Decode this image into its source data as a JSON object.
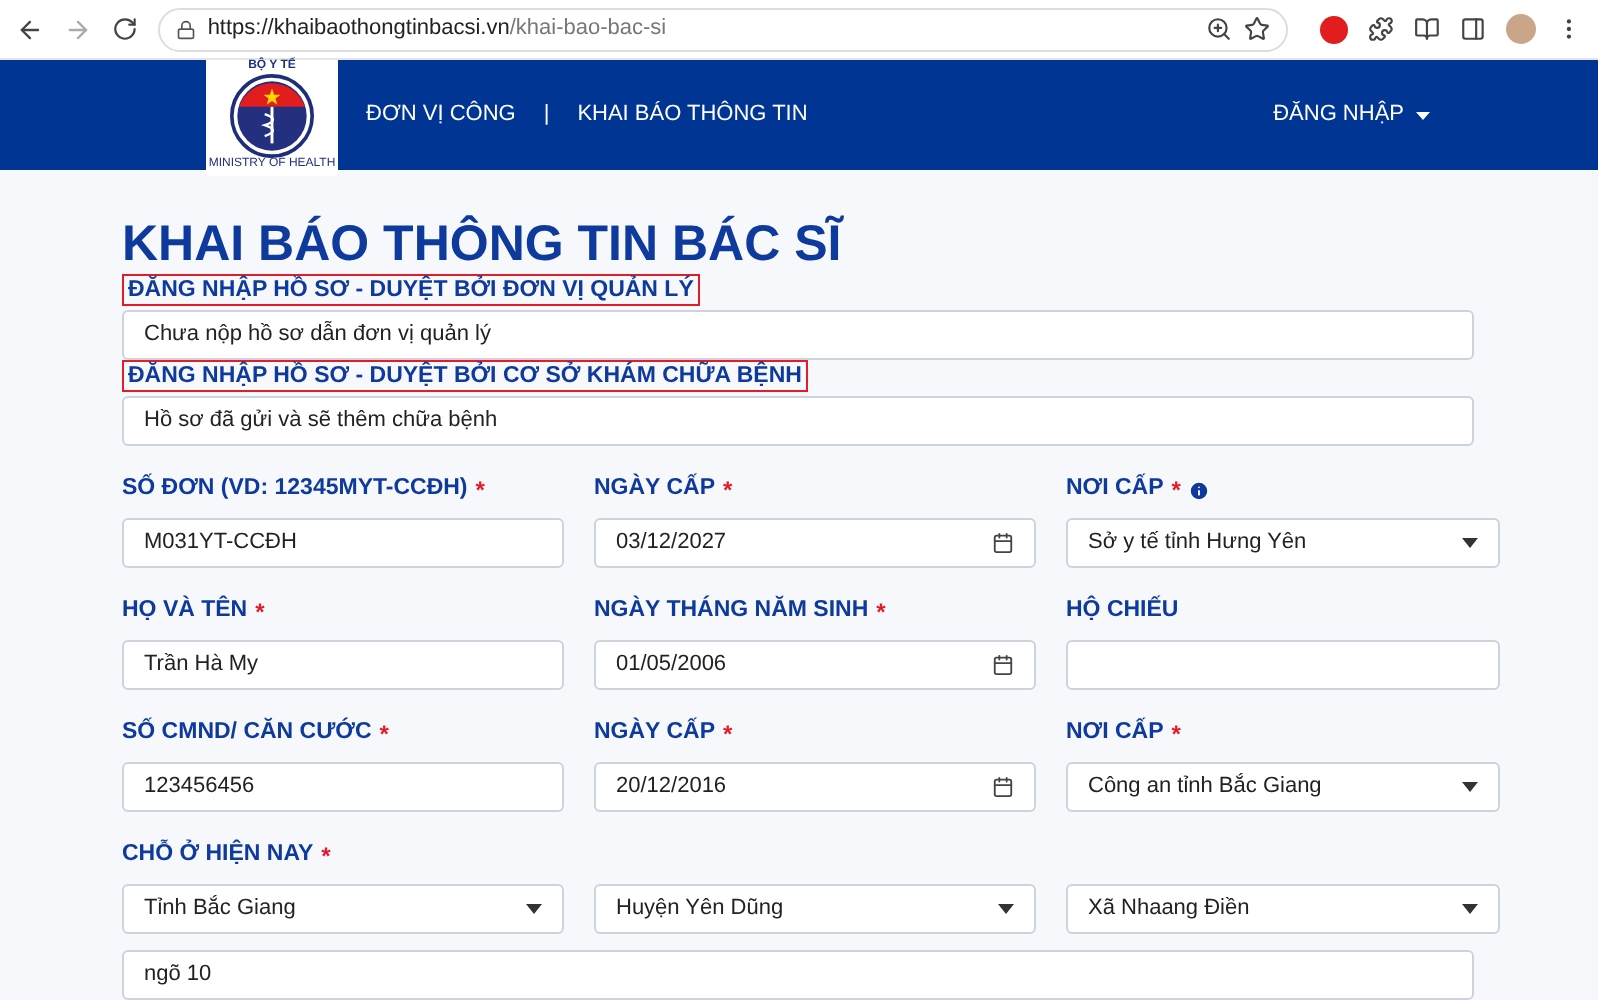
{
  "browser": {
    "url_host": "https://khaibaothongtinbacsi.vn",
    "url_path": "/khai-bao-bac-si"
  },
  "header": {
    "logo_top": "BỘ Y TẾ",
    "logo_bottom": "MINISTRY OF HEALTH",
    "nav": [
      "ĐƠN VỊ CÔNG",
      "KHAI BÁO THÔNG TIN"
    ],
    "separator": "|",
    "login": "ĐĂNG NHẬP"
  },
  "title": "KHAI BÁO THÔNG TIN BÁC SĨ",
  "status_sections": [
    {
      "label": "ĐĂNG NHẬP HỒ SƠ - DUYỆT BỞI ĐƠN VỊ QUẢN LÝ",
      "value": "Chưa nộp hồ sơ dẫn đơn vị quản lý",
      "highlighted": true
    },
    {
      "label": "ĐĂNG NHẬP HỒ SƠ - DUYỆT BỞI CƠ SỞ KHÁM CHỮA BỆNH",
      "value": "Hồ sơ đã gửi và sẽ thêm chữa bệnh",
      "highlighted": true
    }
  ],
  "field_rows": [
    [
      {
        "label": "SỐ ĐƠN (VD: 12345MYT-CCĐH)",
        "required": true,
        "info": false,
        "kind": "text",
        "value": "M031YT-CCĐH"
      },
      {
        "label": "NGÀY CẤP",
        "required": true,
        "info": false,
        "kind": "date",
        "value": "03/12/2027"
      },
      {
        "label": "NƠI CẤP",
        "required": true,
        "info": true,
        "kind": "select",
        "value": "Sở y tế tỉnh Hưng Yên"
      }
    ],
    [
      {
        "label": "HỌ VÀ TÊN",
        "required": true,
        "info": false,
        "kind": "text",
        "value": "Trần Hà My"
      },
      {
        "label": "NGÀY THÁNG NĂM SINH",
        "required": true,
        "info": false,
        "kind": "date",
        "value": "01/05/2006"
      },
      {
        "label": "HỘ CHIẾU",
        "required": false,
        "info": false,
        "kind": "text"
      }
    ],
    [
      {
        "label": "SỐ CMND/ CĂN CƯỚC",
        "required": true,
        "info": false,
        "kind": "text",
        "value": "123456456"
      },
      {
        "label": "NGÀY CẤP",
        "required": true,
        "info": false,
        "kind": "date",
        "value": "20/12/2016"
      },
      {
        "label": "NƠI CẤP",
        "required": true,
        "info": false,
        "kind": "select",
        "value": "Công an tỉnh Bắc Giang"
      }
    ]
  ],
  "residence": {
    "label": "CHỖ Ở HIỆN NAY",
    "required": true,
    "selects": [
      "Tỉnh Bắc Giang",
      "Huyện Yên Dũng",
      "Xã Nhaang Điền"
    ],
    "address": "ngõ 10"
  },
  "required_mark": "*"
}
